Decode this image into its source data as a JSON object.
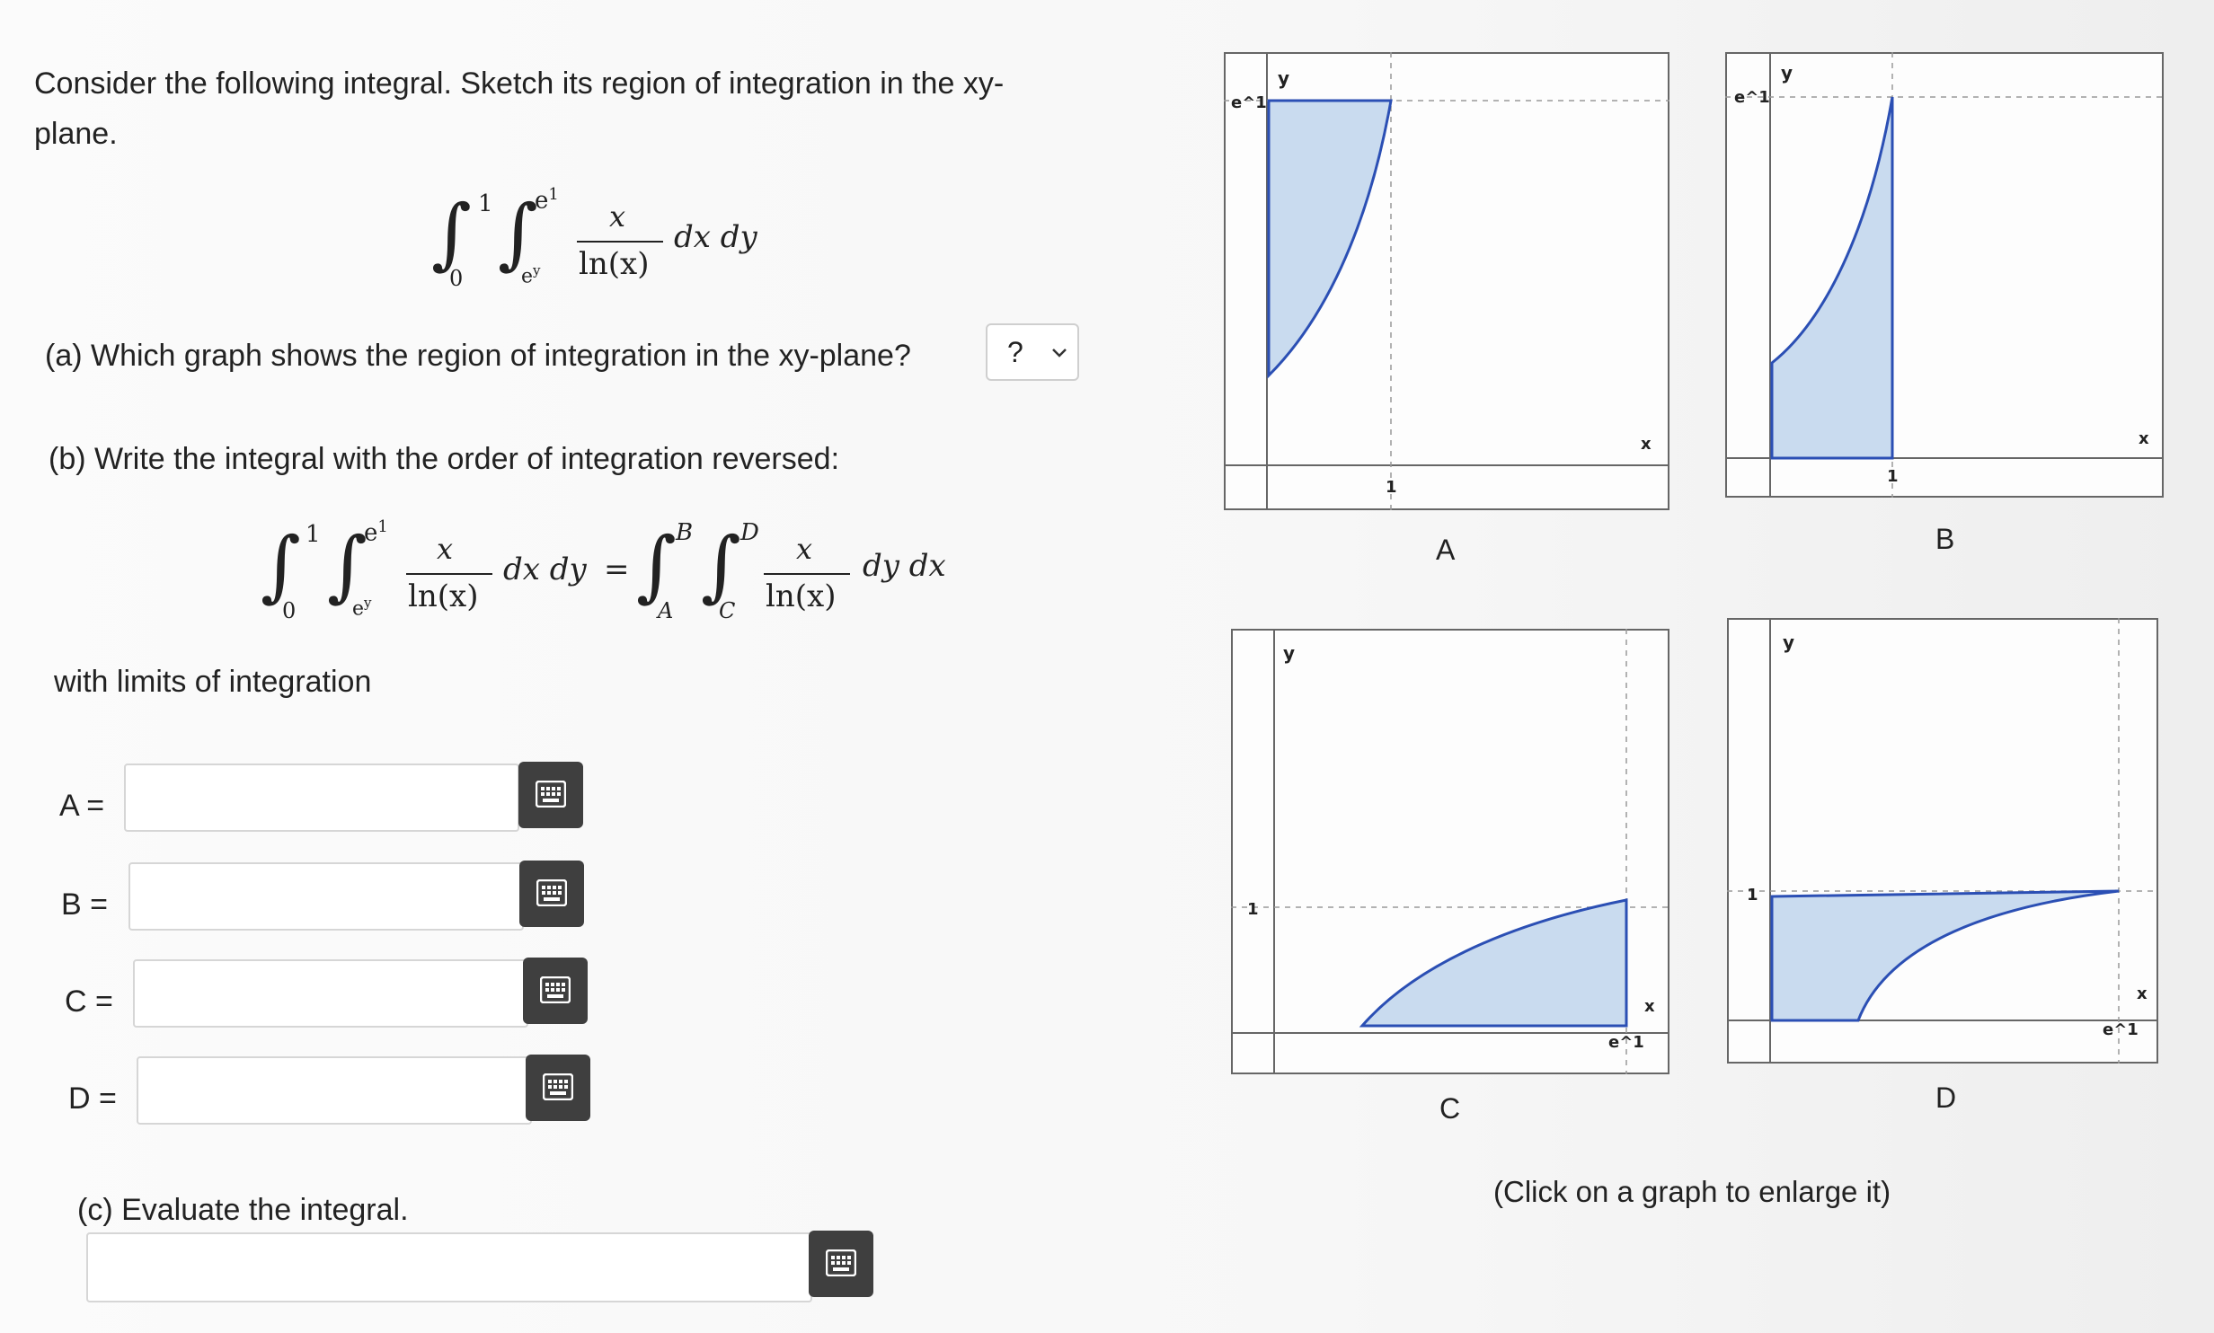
{
  "question": {
    "intro": "Consider the following integral. Sketch its region of integration in the xy-",
    "intro2": "plane.",
    "part_a": "(a) Which graph shows the region of integration in the xy-plane?",
    "part_a_select": "?",
    "part_b": "(b) Write the integral with the order of integration reversed:",
    "with_limits": "with limits of integration",
    "part_c": "(c) Evaluate the integral.",
    "click_hint": "(Click on a graph to enlarge it)"
  },
  "integral": {
    "lower_outer": "0",
    "upper_outer": "1",
    "lower_inner": "e",
    "lower_inner_exp": "y",
    "upper_inner": "e",
    "upper_inner_exp": "1",
    "numerator": "x",
    "denominator": "ln(x)",
    "order": "dx dy",
    "rev_lower_outer": "A",
    "rev_upper_outer": "B",
    "rev_lower_inner": "C",
    "rev_upper_inner": "D",
    "rev_order": "dy dx",
    "equals": "="
  },
  "fields": [
    {
      "label": "A =",
      "value": ""
    },
    {
      "label": "B =",
      "value": ""
    },
    {
      "label": "C =",
      "value": ""
    },
    {
      "label": "D =",
      "value": ""
    }
  ],
  "graphs": {
    "A": {
      "caption": "A",
      "y_label": "y",
      "x_label": "x",
      "y_tick": "e^1",
      "x_tick": "1"
    },
    "B": {
      "caption": "B",
      "y_label": "y",
      "x_label": "x",
      "y_tick": "e^1",
      "x_tick": "1"
    },
    "C": {
      "caption": "C",
      "y_label": "y",
      "x_label": "x",
      "y_tick": "1",
      "x_tick": "e^1"
    },
    "D": {
      "caption": "D",
      "y_label": "y",
      "x_label": "x",
      "y_tick": "1",
      "x_tick": "e^1"
    }
  },
  "colors": {
    "fill": "#c9dbef",
    "curve": "#2b4fb4",
    "keyboard_button": "#3f3f3f"
  },
  "icons": {
    "keyboard": "keyboard-icon",
    "dropdown": "chevron-down-icon"
  }
}
